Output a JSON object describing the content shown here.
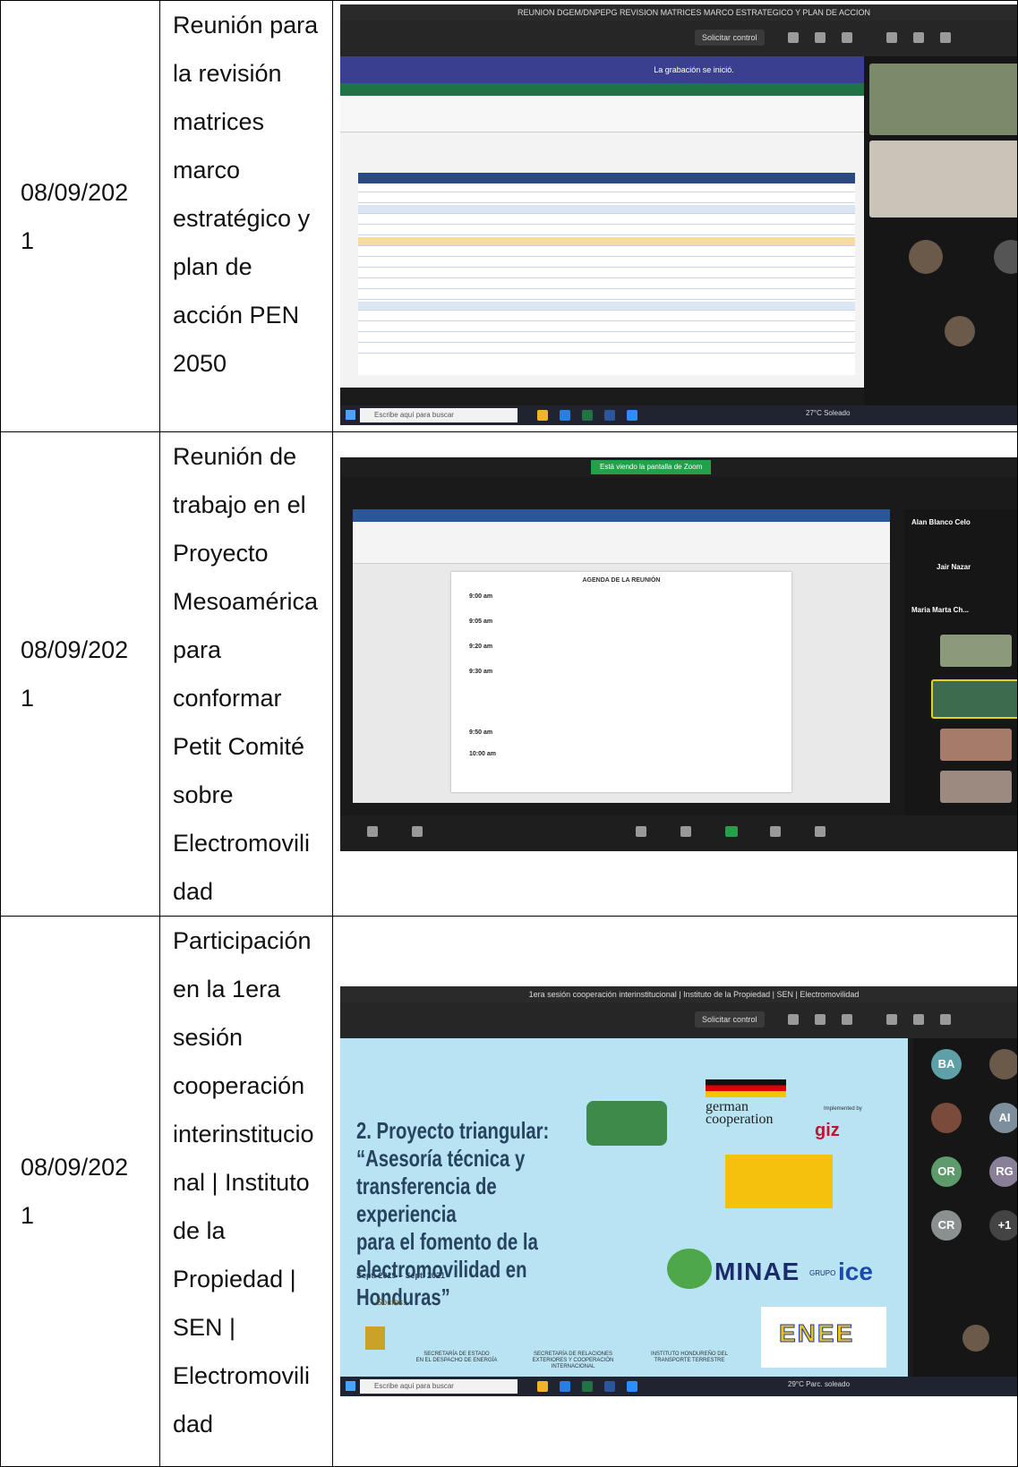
{
  "rows": [
    {
      "date": "08/09/202\n1",
      "activity": "Reunión para\nla revisión\nmatrices\nmarco\nestratégico y\nplan de\nacción PEN\n2050",
      "screenshot": {
        "window_title": "REUNION DGEM/DNPEPG REVISION MATRICES MARCO ESTRATEGICO Y PLAN DE ACCION",
        "control_button": "Solicitar control",
        "recording_notice": "La grabación se inició.",
        "taskbar_search": "Escribe aquí para buscar",
        "weather": "27°C Soleado"
      }
    },
    {
      "date": "08/09/202\n1",
      "activity": "Reunión de\ntrabajo en el\nProyecto\nMesoamérica\npara\nconformar\nPetit Comité\nsobre\nElectromovili\ndad",
      "screenshot": {
        "sharing_label": "Está viendo la pantalla de Zoom",
        "participants": [
          "Alan Blanco Celo",
          "Jair Nazar",
          "Maria Marta Ch..."
        ],
        "agenda_title": "AGENDA DE LA REUNIÓN",
        "agenda_times": [
          "9:00 am",
          "9:05 am",
          "9:20 am",
          "9:30 am",
          "9:50 am",
          "10:00 am"
        ]
      }
    },
    {
      "date": "08/09/202\n1",
      "activity": "Participación\nen la 1era\nsesión\ncooperación\ninterinstitucio\nnal | Instituto\nde la\nPropiedad |\nSEN |\nElectromovili\ndad",
      "screenshot": {
        "window_title": "1era sesión cooperación interinstitucional | Instituto de la Propiedad | SEN | Electromovilidad",
        "control_button": "Solicitar control",
        "slide_title": "2. Proyecto triangular:\n“Asesoría técnica y\ntransferencia de experiencia\npara el fomento de la\nelectromovilidad en Honduras”",
        "slide_dates": "Sept. 2019 – Sept. 2021",
        "slide_socios": "Socios:",
        "logo_german": "german\ncooperation",
        "logo_impl": "Implemented by",
        "logo_giz": "giz",
        "logo_minae": "MINAE",
        "logo_grupo": "GRUPO",
        "logo_ice": "ice",
        "logo_enee": "ENEE",
        "partners": [
          "SECRETARÍA DE ESTADO\nEN EL DESPACHO DE ENERGÍA",
          "SECRETARÍA DE RELACIONES\nEXTERIORES Y COOPERACIÓN\nINTERNACIONAL",
          "INSTITUTO HONDUREÑO DEL\nTRANSPORTE TERRESTRE"
        ],
        "avatars": [
          "BA",
          "AI",
          "OR",
          "RG",
          "CR",
          "+1"
        ],
        "taskbar_search": "Escribe aquí para buscar",
        "weather": "29°C Parc. soleado"
      }
    }
  ],
  "colors": {
    "zoom_bg": "#1b1b1b",
    "banner": "#3b3f8f",
    "slide_bg": "#b7e3f3",
    "excel_green": "#217346",
    "word_blue": "#2b579a"
  }
}
